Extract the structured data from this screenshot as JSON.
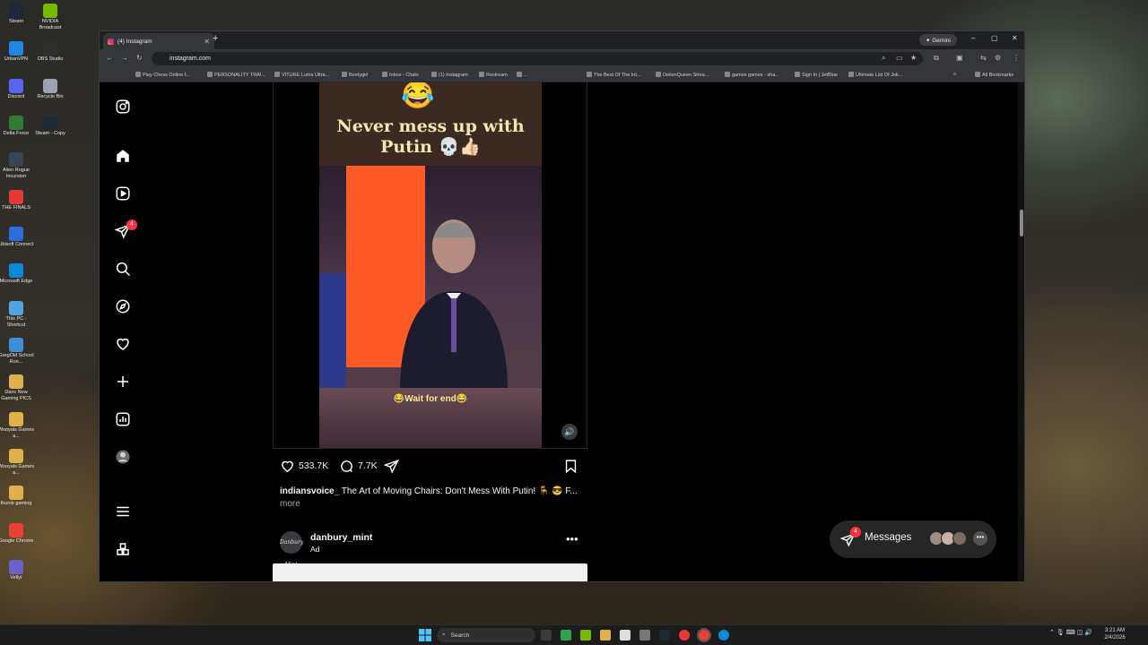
{
  "desktop": {
    "icons": [
      {
        "label": "Steam",
        "color": "#1b2838"
      },
      {
        "label": "NVIDIA Broadcast",
        "color": "#76b900"
      },
      {
        "label": "UrbanVPN",
        "color": "#1e88e5"
      },
      {
        "label": "OBS Studio",
        "color": "#302e31"
      },
      {
        "label": "Discord",
        "color": "#5865f2"
      },
      {
        "label": "Recycle Bin",
        "color": "#9aa4ad"
      },
      {
        "label": "Delta Force",
        "color": "#2e7d32"
      },
      {
        "label": "Steam - Copy",
        "color": "#1b2838"
      },
      {
        "label": "Alien Rogue Incursion",
        "color": "#37474f"
      },
      {
        "label": "THE FINALS",
        "color": "#e53935"
      },
      {
        "label": "Ubisoft Connect",
        "color": "#2a6edc"
      },
      {
        "label": "Microsoft Edge",
        "color": "#0c8ad7"
      },
      {
        "label": "This PC - Shortcut",
        "color": "#4fa3e0"
      },
      {
        "label": "GregOld School Run...",
        "color": "#3f8ed8"
      },
      {
        "label": "Dans New Gaming PICS",
        "color": "#e0b04a"
      },
      {
        "label": "Wooyals Games a...",
        "color": "#e0b04a"
      },
      {
        "label": "Wooyals Games a...",
        "color": "#e0b04a"
      },
      {
        "label": "thumb gaming",
        "color": "#e0b04a"
      },
      {
        "label": "Google Chrome",
        "color": "#e94235"
      },
      {
        "label": "Vellyr",
        "color": "#6b61c9"
      }
    ]
  },
  "browser": {
    "tab_title": "(4) Instagram",
    "new_tab": "+",
    "gemini": "✦ Gemini",
    "url": "instagram.com",
    "window_controls": {
      "minimize": "–",
      "maximize": "▢",
      "close": "✕"
    },
    "bookmarks": [
      "Play Chess Online f...",
      "PERSONALITY TRAI...",
      "VITURE Luma Ultra...",
      "Beetygirl",
      "Inbox - Chats",
      "(1) Instagram",
      "Restream",
      "...",
      "The Best Of The Int...",
      "DeilenQueen Strea...",
      "games games - sha...",
      "Sign In | JetBlue",
      "Ultimate List Of Jok...",
      "»",
      "All Bookmarks"
    ]
  },
  "instagram": {
    "nav_badge": "4",
    "video": {
      "emoji_top": "😂",
      "caption_line1": "Never mess up with",
      "caption_line2": "Putin 💀👍🏻",
      "caption_bottom": "😂Wait for end😂",
      "volume_icon": "🔊"
    },
    "post": {
      "likes": "533.7K",
      "comments": "7.7K",
      "username": "indiansvoice_",
      "caption": "The Art of Moving Chairs: Don't Mess With Putin! 🪑 😎 F...",
      "more": "more"
    },
    "ad": {
      "username": "danbury_mint",
      "label": "Ad",
      "avatar_text": "Danbury Mint",
      "more": "•••"
    },
    "messages": {
      "label": "Messages",
      "badge": "4",
      "more": "•••"
    }
  },
  "taskbar": {
    "search_placeholder": "Search",
    "time": "3:21 AM",
    "date": "2/4/2026"
  }
}
